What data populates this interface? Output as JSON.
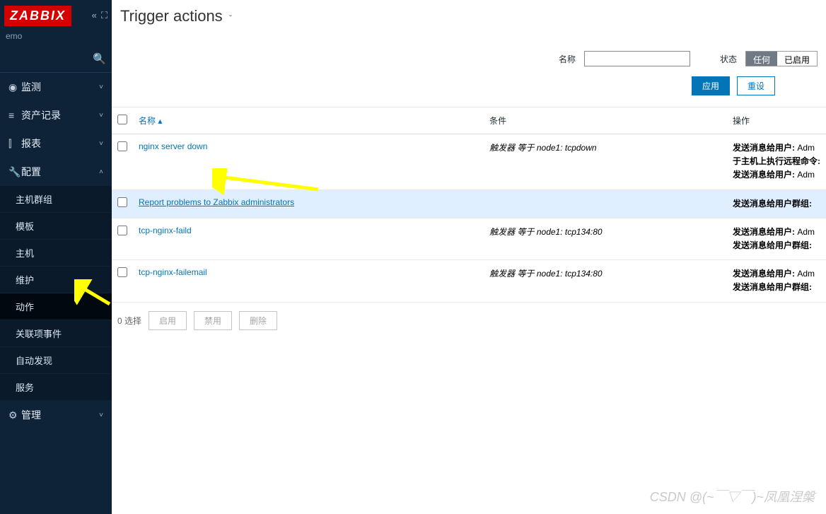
{
  "brand": {
    "logo": "ZABBIX",
    "server": "emo"
  },
  "nav": {
    "items": [
      {
        "icon": "◉",
        "label": "监测"
      },
      {
        "icon": "≡",
        "label": "资产记录"
      },
      {
        "icon": "⫿",
        "label": "报表"
      },
      {
        "icon": "🔧",
        "label": "配置",
        "expanded": true
      },
      {
        "icon": "⚙",
        "label": "管理"
      }
    ],
    "sub": [
      "主机群组",
      "模板",
      "主机",
      "维护",
      "动作",
      "关联项事件",
      "自动发现",
      "服务"
    ],
    "active_sub": "动作"
  },
  "page": {
    "title": "Trigger actions"
  },
  "filter": {
    "name_label": "名称",
    "name_value": "",
    "status_label": "状态",
    "status_opts": [
      "任何",
      "已启用"
    ],
    "status_sel": "任何",
    "apply": "应用",
    "reset": "重设"
  },
  "table": {
    "head": {
      "name": "名称",
      "sort": "▴",
      "cond": "条件",
      "op": "操作"
    },
    "rows": [
      {
        "name": "nginx server down",
        "cond": "触发器 等于 node1: tcpdown",
        "ops": [
          "发送消息给用户: Adm",
          "于主机上执行远程命令",
          "发送消息给用户: Adm"
        ],
        "hl": false
      },
      {
        "name": "Report problems to Zabbix administrators",
        "cond": "",
        "ops": [
          "发送消息给用户群组:"
        ],
        "hl": true
      },
      {
        "name": "tcp-nginx-faild",
        "cond": "触发器 等于 node1: tcp134:80",
        "ops": [
          "发送消息给用户: Adm",
          "发送消息给用户群组:"
        ],
        "hl": false
      },
      {
        "name": "tcp-nginx-failemail",
        "cond": "触发器 等于 node1: tcp134:80",
        "ops": [
          "发送消息给用户: Adm",
          "发送消息给用户群组:"
        ],
        "hl": false
      }
    ]
  },
  "footer": {
    "selected": "0 选择",
    "enable": "启用",
    "disable": "禁用",
    "delete": "删除"
  },
  "watermark": "CSDN @(~￣▽￣)~凤凰涅槃"
}
